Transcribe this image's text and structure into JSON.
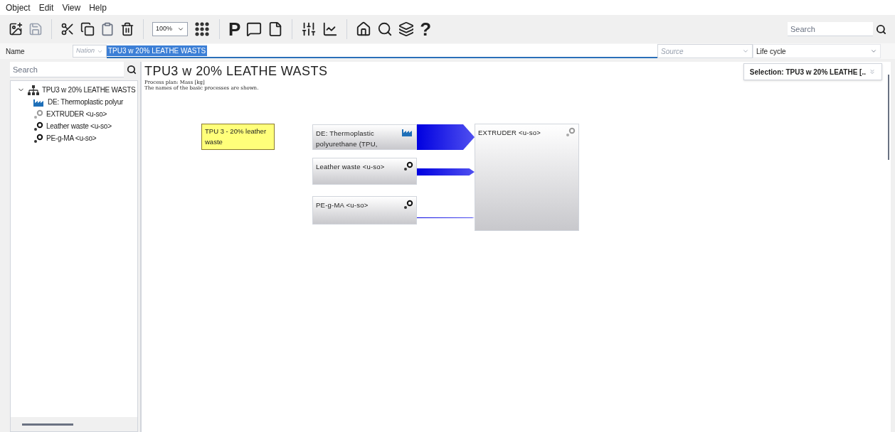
{
  "menu": [
    "Object",
    "Edit",
    "View",
    "Help"
  ],
  "toolbar": {
    "zoom": "100%",
    "letter_button": "P",
    "help_button": "?",
    "search": {
      "placeholder": "Search"
    }
  },
  "name_row": {
    "label": "Name",
    "prefix": {
      "placeholder": "Nation"
    },
    "value": "TPU3 w 20% LEATHE WASTS",
    "source": {
      "placeholder": "Source"
    },
    "stage": "Life cycle"
  },
  "sidebar": {
    "search": {
      "placeholder": "Search"
    },
    "tree": [
      {
        "label": "TPU3 w 20% LEATHE WASTS",
        "kind": "assembly",
        "expanded": true,
        "children": [
          {
            "label": "DE: Thermoplastic polyur",
            "kind": "factory"
          },
          {
            "label": "EXTRUDER <u-so>",
            "kind": "process"
          },
          {
            "label": "Leather waste <u-so>",
            "kind": "process-dark"
          },
          {
            "label": "PE-g-MA <u-so>",
            "kind": "process-dark"
          }
        ]
      }
    ]
  },
  "canvas": {
    "title": "TPU3 w 20% LEATHE WASTS",
    "subtitle": "Process plan: Mass [kg]",
    "note_line": "The names of the basic processes are shown.",
    "selection": "Selection: TPU3 w 20% LEATHE [..",
    "comment": "TPU 3 - 20% leather waste",
    "nodes": [
      {
        "label": "DE: Thermoplastic polyurethane (TPU,",
        "kind": "factory"
      },
      {
        "label": "Leather waste <u-so>",
        "kind": "process-dark"
      },
      {
        "label": "PE-g-MA <u-so>",
        "kind": "process-dark"
      },
      {
        "label": "EXTRUDER <u-so>",
        "kind": "process"
      }
    ],
    "flows": [
      {
        "kind": "thick"
      },
      {
        "kind": "medium"
      },
      {
        "kind": "thin"
      }
    ]
  }
}
